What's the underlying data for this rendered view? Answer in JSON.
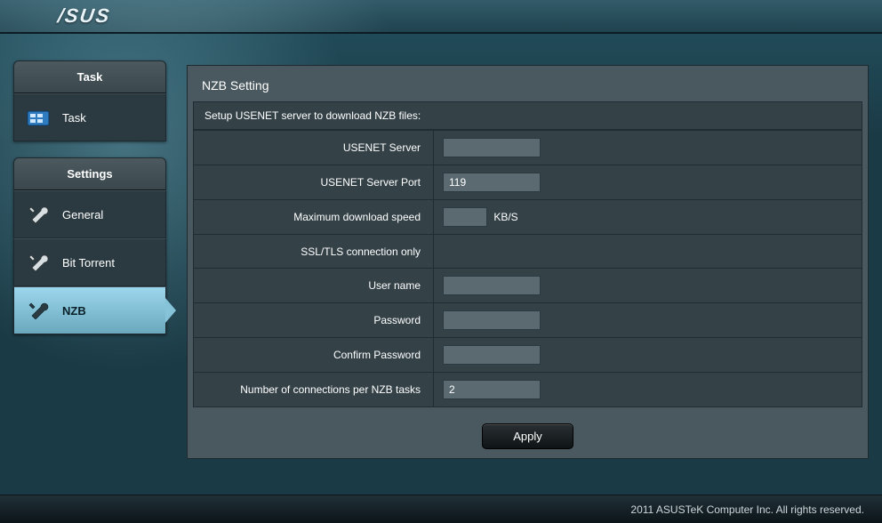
{
  "brand": "/SUS",
  "sidebar": {
    "task_header": "Task",
    "task_item": "Task",
    "settings_header": "Settings",
    "items": [
      {
        "label": "General"
      },
      {
        "label": "Bit Torrent"
      },
      {
        "label": "NZB"
      }
    ]
  },
  "panel": {
    "title": "NZB Setting",
    "subtitle": "Setup USENET server to download NZB files:"
  },
  "fields": {
    "server_label": "USENET Server",
    "server_value": "",
    "port_label": "USENET Server Port",
    "port_value": "119",
    "speed_label": "Maximum download speed",
    "speed_value": "",
    "speed_unit": "KB/S",
    "ssl_label": "SSL/TLS connection only",
    "user_label": "User name",
    "user_value": "",
    "pass_label": "Password",
    "pass_value": "",
    "confirm_label": "Confirm Password",
    "confirm_value": "",
    "conn_label": "Number of connections per NZB tasks",
    "conn_value": "2"
  },
  "apply_label": "Apply",
  "footer": "2011 ASUSTeK Computer Inc. All rights reserved."
}
